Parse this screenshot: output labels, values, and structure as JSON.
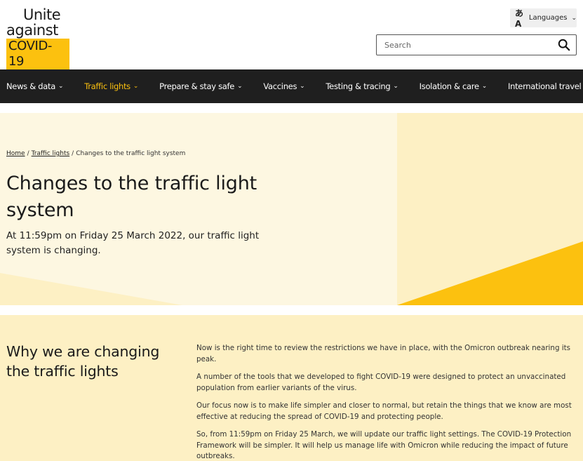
{
  "logo": {
    "line1": "Unite",
    "line2": "against",
    "line3": "COVID-19"
  },
  "header": {
    "languages_label": "Languages",
    "search_placeholder": "Search"
  },
  "nav": {
    "items": [
      {
        "label": "News & data",
        "active": false
      },
      {
        "label": "Traffic lights",
        "active": true
      },
      {
        "label": "Prepare & stay safe",
        "active": false
      },
      {
        "label": "Vaccines",
        "active": false
      },
      {
        "label": "Testing & tracing",
        "active": false
      },
      {
        "label": "Isolation & care",
        "active": false
      },
      {
        "label": "International travel",
        "active": false
      }
    ]
  },
  "breadcrumb": {
    "home": "Home",
    "section": "Traffic lights",
    "current": "Changes to the traffic light system"
  },
  "hero": {
    "title": "Changes to the traffic light system",
    "subtitle": "At 11:59pm on Friday 25 March 2022, our traffic light system is changing."
  },
  "section": {
    "title": "Why we are changing the traffic lights",
    "paragraphs": [
      "Now is the right time to review the restrictions we have in place, with the Omicron outbreak nearing its peak.",
      "A number of the tools that we developed to fight COVID-19 were designed to protect an unvaccinated population from earlier variants of the virus.",
      "Our focus now is to make life simpler and closer to normal, but retain the things that we know are most effective at reducing the spread of COVID-19 and protecting people.",
      "So, from 11:59pm on Friday 25 March, we will update our traffic light settings. The COVID-19 Protection Framework will be simpler. It will help us manage life with Omicron while reducing the impact of future outbreaks."
    ]
  },
  "colors": {
    "brand_yellow": "#fcc10f",
    "nav_bg": "#1f1f1f",
    "hero_bg": "#fdf7e1",
    "section_bg": "#fdf0c4"
  }
}
